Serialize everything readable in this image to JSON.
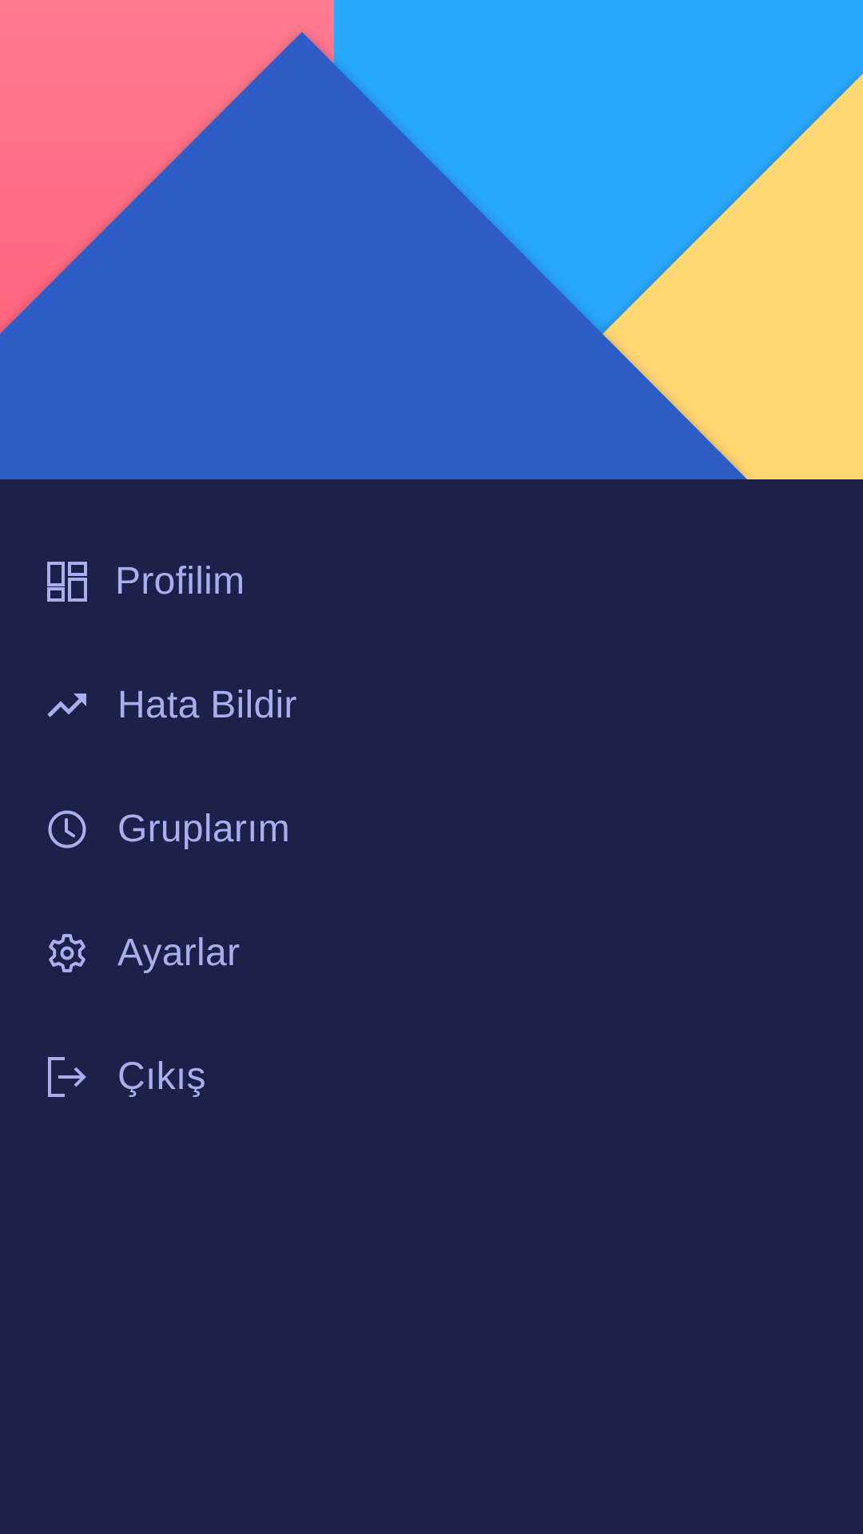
{
  "colors": {
    "background": "#1D2149",
    "header_blue": "#2F5BC5",
    "header_sky": "#29A8FF",
    "header_pink": "#FF6F87",
    "header_yellow": "#FFD873",
    "menu_text": "#A9AEEF"
  },
  "menu": {
    "items": [
      {
        "id": "profile",
        "label": "Profilim",
        "icon": "dashboard-icon"
      },
      {
        "id": "report",
        "label": "Hata Bildir",
        "icon": "trending-up-icon"
      },
      {
        "id": "groups",
        "label": "Gruplarım",
        "icon": "clock-icon"
      },
      {
        "id": "settings",
        "label": "Ayarlar",
        "icon": "gear-icon"
      },
      {
        "id": "logout",
        "label": "Çıkış",
        "icon": "logout-icon"
      }
    ]
  }
}
